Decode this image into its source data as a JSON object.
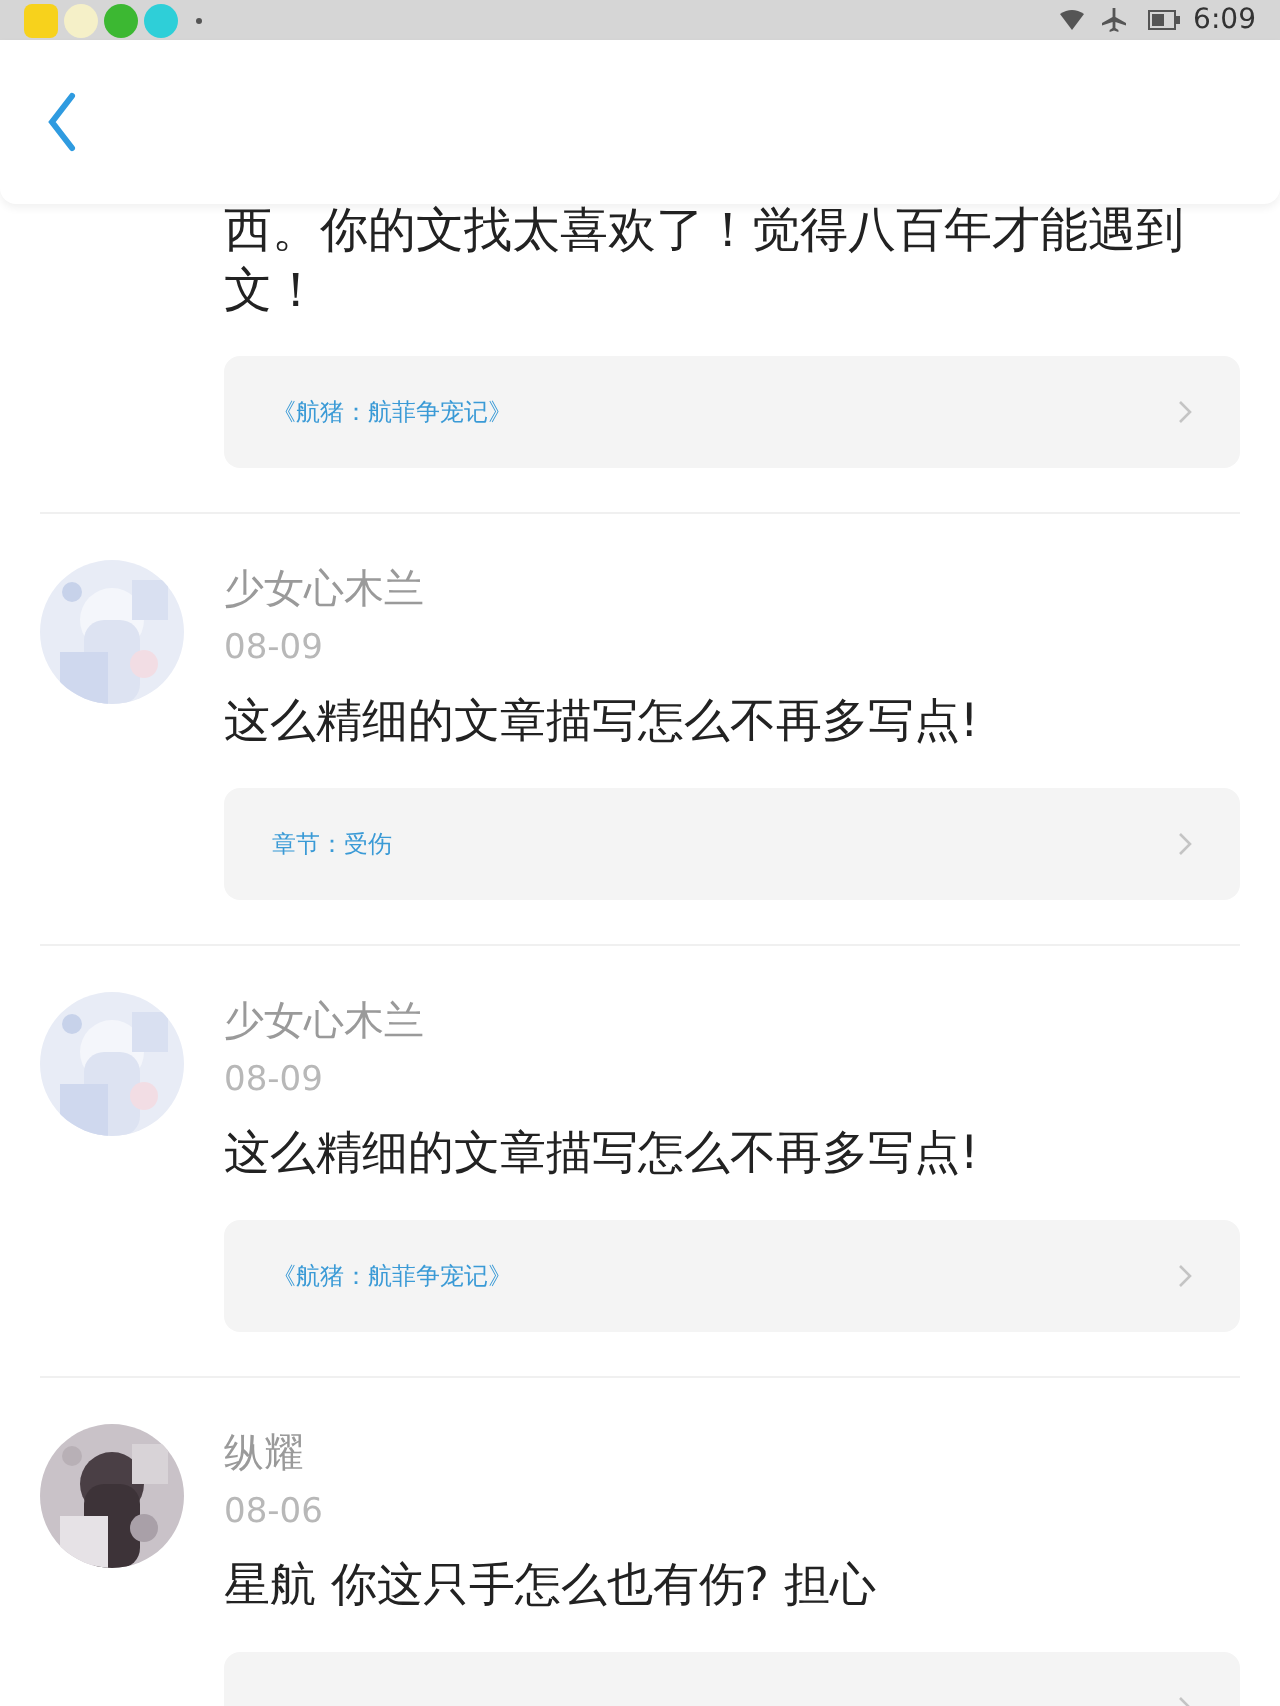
{
  "status_bar": {
    "time": "6:09"
  },
  "comments": [
    {
      "partial": true,
      "text": "西。你的文找太喜欢了！觉得八百年才能遇到文！",
      "link": "《航猪：航菲争宠记》"
    },
    {
      "partial": false,
      "name": "少女心木兰",
      "date": "08-09",
      "text": "这么精细的文章描写怎么不再多写点!",
      "link": "章节：受伤"
    },
    {
      "partial": false,
      "name": "少女心木兰",
      "date": "08-09",
      "text": "这么精细的文章描写怎么不再多写点!",
      "link": "《航猪：航菲争宠记》"
    },
    {
      "partial": false,
      "name": "纵耀",
      "date": "08-06",
      "text": "星航 你这只手怎么也有伤? 担心"
    }
  ]
}
